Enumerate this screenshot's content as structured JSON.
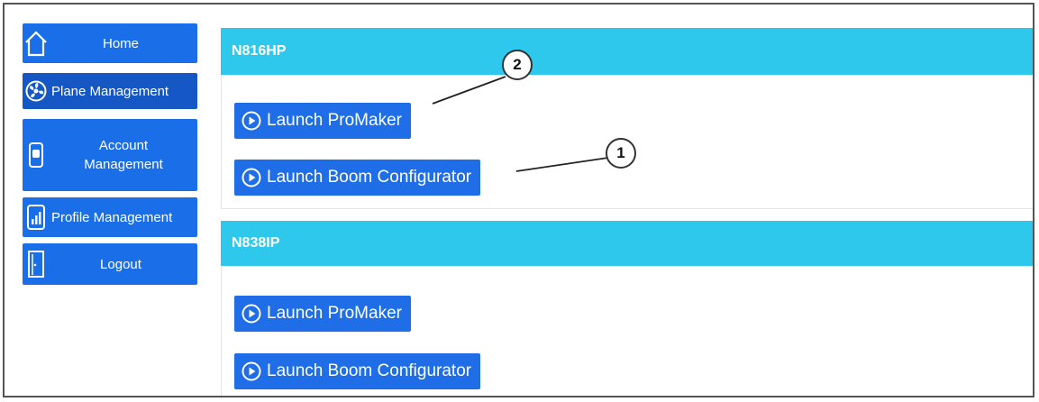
{
  "sidebar": {
    "items": [
      {
        "label": "Home",
        "icon": "home-icon"
      },
      {
        "label": "Plane Management",
        "icon": "propeller-icon"
      },
      {
        "label": "Account Management",
        "icon": "phone-icon"
      },
      {
        "label": "Profile Management",
        "icon": "tablet-chart-icon"
      },
      {
        "label": "Logout",
        "icon": "door-icon"
      }
    ]
  },
  "planes": [
    {
      "tail": "N816HP",
      "buttons": [
        "Launch ProMaker",
        "Launch Boom Configurator"
      ]
    },
    {
      "tail": "N838IP",
      "buttons": [
        "Launch ProMaker",
        "Launch Boom Configurator"
      ]
    }
  ],
  "callouts": [
    "2",
    "1"
  ],
  "colors": {
    "sidebar": "#1a6fe8",
    "header": "#2ec8ec",
    "button": "#1f6ee8"
  }
}
